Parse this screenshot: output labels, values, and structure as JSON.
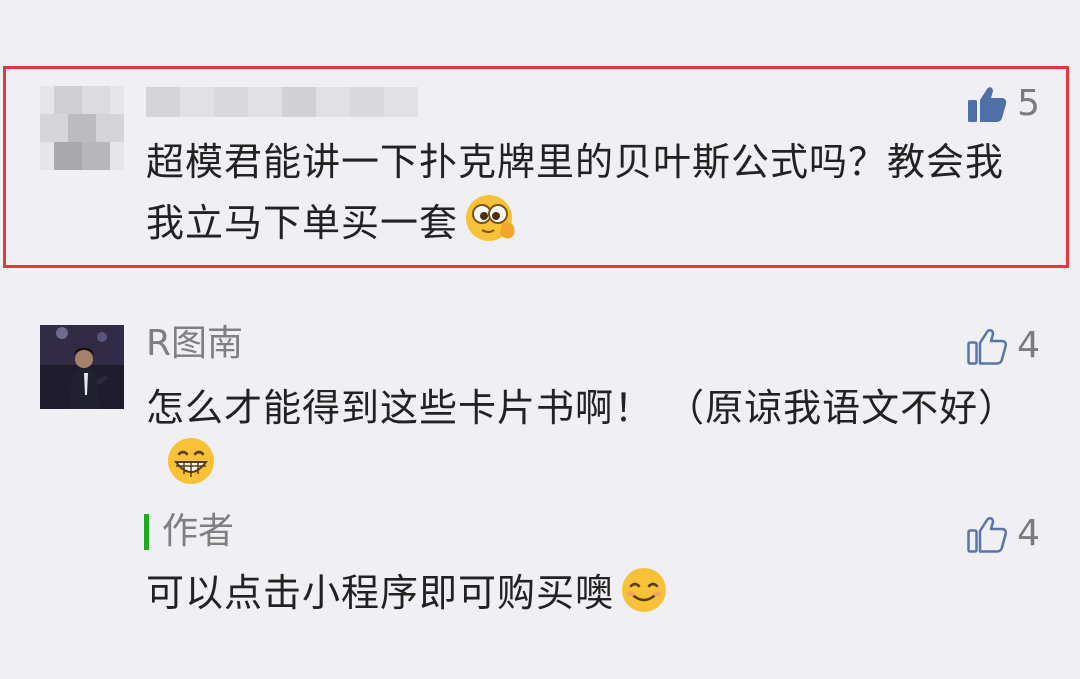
{
  "comments": [
    {
      "name": "",
      "likes": "5",
      "text": "超模君能讲一下扑克牌里的贝叶斯公式吗？教会我我立马下单买一套",
      "emoji": "eyes-peek-emoji",
      "liked": true
    },
    {
      "name": "R图南",
      "likes": "4",
      "text": "怎么才能得到这些卡片书啊！ （原谅我语文不好）",
      "emoji": "grin-emoji",
      "liked": false
    }
  ],
  "author_reply": {
    "label": "作者",
    "likes": "4",
    "text": "可以点击小程序即可购买噢",
    "emoji": "smile-emoji"
  },
  "colors": {
    "background": "#efeff4",
    "highlight_border": "#e8363c",
    "author_bar": "#1aad19",
    "like_filled": "#4e6fa8",
    "like_outline": "#5a74a6"
  }
}
